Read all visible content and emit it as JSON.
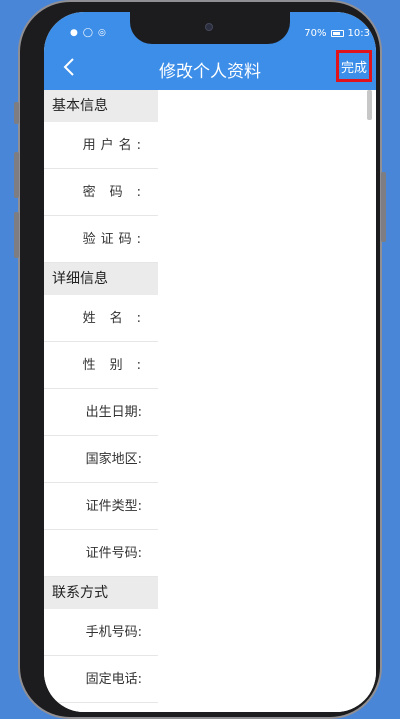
{
  "status_bar": {
    "battery": "70%",
    "time": "10:3"
  },
  "nav": {
    "title": "修改个人资料",
    "done_label": "完成"
  },
  "sections": {
    "basic": {
      "title": "基本信息",
      "fields": [
        "用户名:",
        "密码:",
        "验证码:"
      ]
    },
    "detail": {
      "title": "详细信息",
      "fields": [
        "姓名:",
        "性别:",
        "出生日期:",
        "国家地区:",
        "证件类型:",
        "证件号码:"
      ]
    },
    "contact": {
      "title": "联系方式",
      "fields": [
        "手机号码:",
        "固定电话:"
      ]
    }
  },
  "colors": {
    "accent": "#3d8ee8",
    "highlight": "#e0121b",
    "background": "#4a86d8"
  }
}
